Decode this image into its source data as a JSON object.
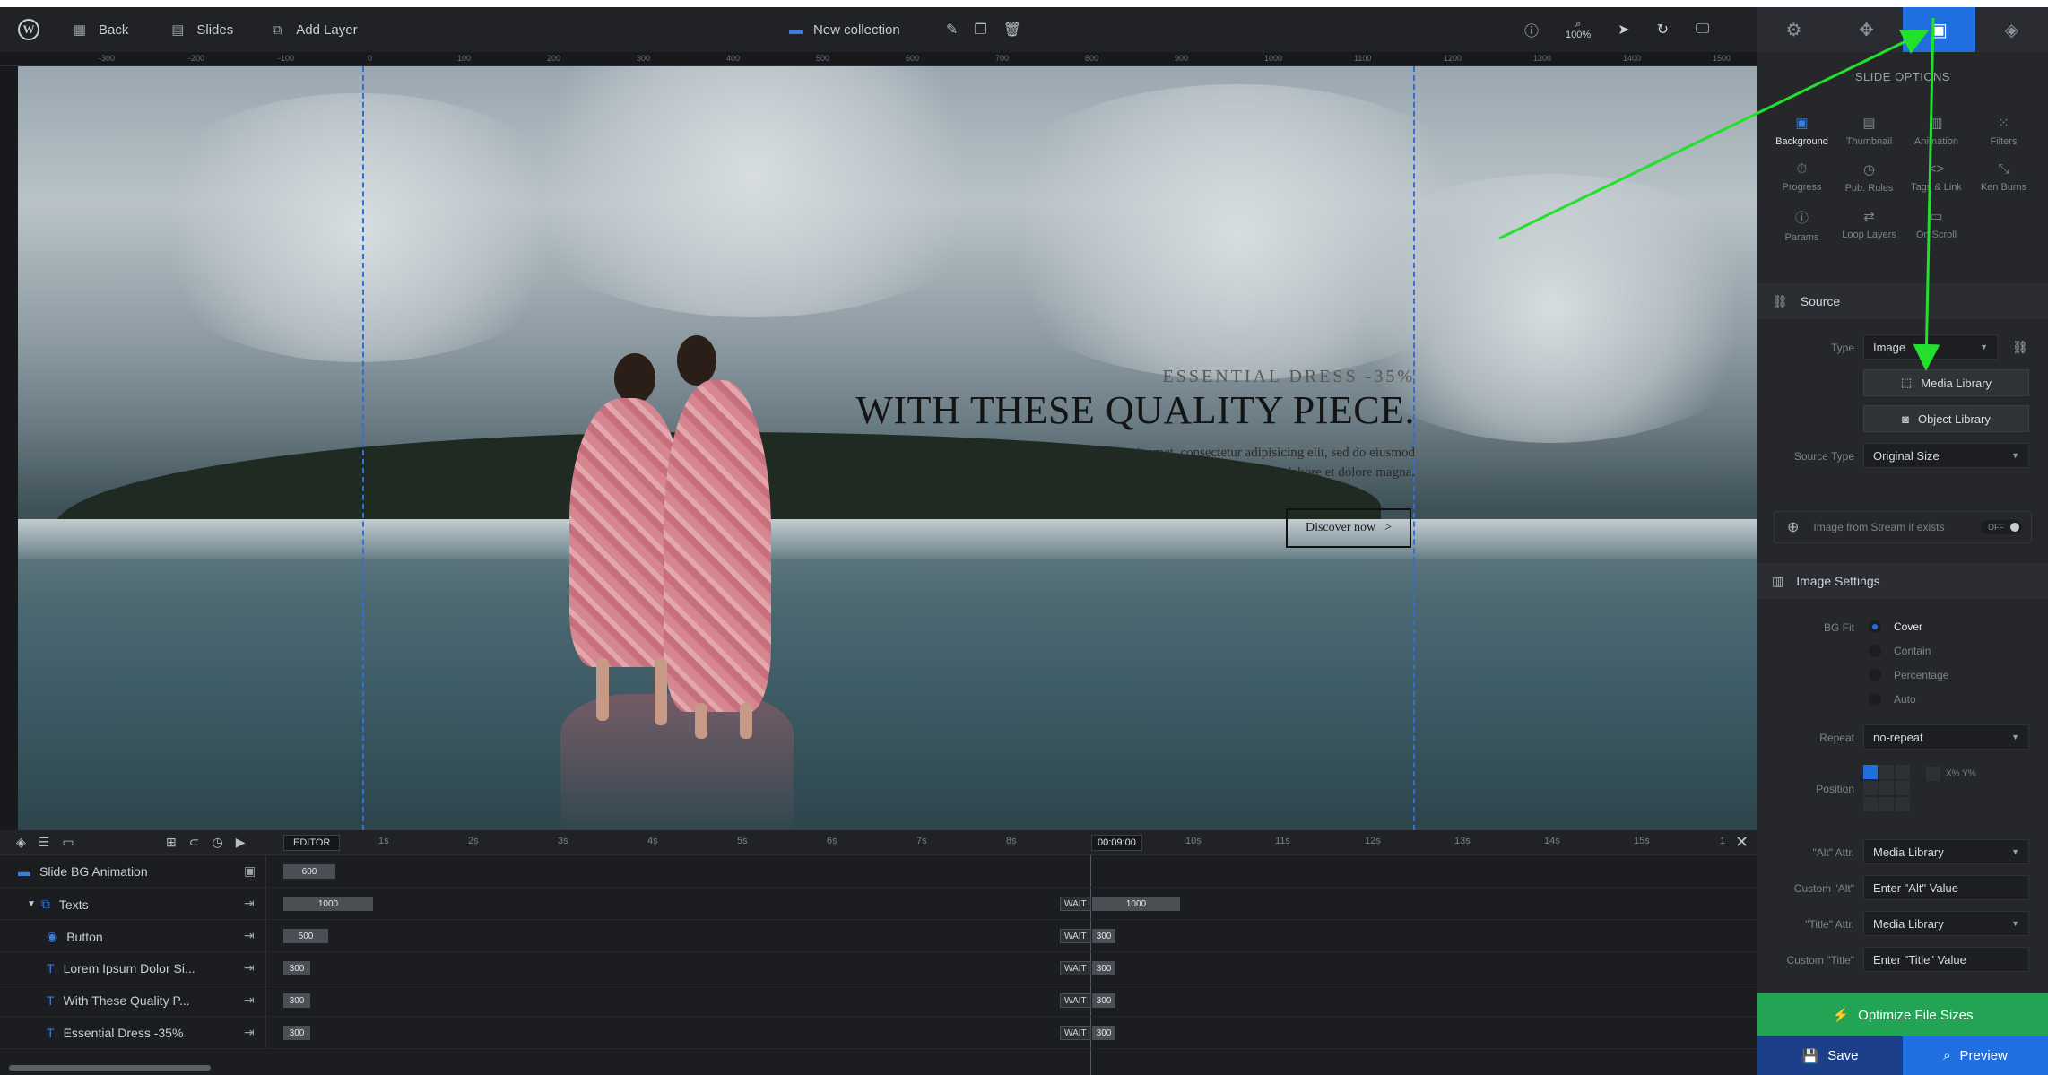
{
  "topbar": {
    "back": "Back",
    "slides": "Slides",
    "add_layer": "Add Layer",
    "collection": "New collection",
    "zoom": "100%"
  },
  "ruler": [
    "-300",
    "-200",
    "-100",
    "0",
    "100",
    "200",
    "300",
    "400",
    "500",
    "600",
    "700",
    "800",
    "900",
    "1000",
    "1100",
    "1200",
    "1300",
    "1400",
    "1500"
  ],
  "slide": {
    "kicker": "ESSENTIAL DRESS -35%",
    "headline": "WITH THESE QUALITY PIECE.",
    "body_line1": "Lorem ipsum dolor sit amet, consectetur adipisicing elit, sed do eiusmod",
    "body_line2": "tempor incididunt ut labore et dolore magna.",
    "cta": "Discover now",
    "cta_arrow": ">"
  },
  "timeline": {
    "editor": "EDITOR",
    "current_time": "00:09:00",
    "ticks": [
      "1s",
      "2s",
      "3s",
      "4s",
      "5s",
      "6s",
      "7s",
      "8s",
      "10s",
      "11s",
      "12s",
      "13s",
      "14s",
      "15s",
      "1"
    ],
    "rows": [
      {
        "name": "Slide BG Animation",
        "bar": "600"
      },
      {
        "name": "Texts",
        "bar": "1000",
        "wait": "WAIT",
        "end": "1000"
      },
      {
        "name": "Button",
        "bar": "500",
        "wait": "WAIT",
        "end": "300"
      },
      {
        "name": "Lorem Ipsum Dolor Si...",
        "bar": "300",
        "wait": "WAIT",
        "end": "300"
      },
      {
        "name": "With These Quality P...",
        "bar": "300",
        "wait": "WAIT",
        "end": "300"
      },
      {
        "name": "Essential Dress -35%",
        "bar": "300",
        "wait": "WAIT",
        "end": "300"
      }
    ]
  },
  "panel": {
    "title": "SLIDE OPTIONS",
    "options": [
      "Background",
      "Thumbnail",
      "Animation",
      "Filters",
      "Progress",
      "Pub. Rules",
      "Tags & Link",
      "Ken Burns",
      "Params",
      "Loop Layers",
      "On Scroll"
    ],
    "source_section": "Source",
    "type_label": "Type",
    "type_value": "Image",
    "media_library": "Media Library",
    "object_library": "Object Library",
    "source_type_label": "Source Type",
    "source_type_value": "Original Size",
    "stream_label": "Image from Stream if exists",
    "stream_toggle": "OFF",
    "image_settings": "Image Settings",
    "bgfit_label": "BG Fit",
    "bgfit_options": [
      "Cover",
      "Contain",
      "Percentage",
      "Auto"
    ],
    "repeat_label": "Repeat",
    "repeat_value": "no-repeat",
    "position_label": "Position",
    "position_xy": "X% Y%",
    "alt_label": "\"Alt\" Attr.",
    "alt_value": "Media Library",
    "custom_alt_label": "Custom \"Alt\"",
    "custom_alt_placeholder": "Enter \"Alt\" Value",
    "title_label": "\"Title\" Attr.",
    "title_value": "Media Library",
    "custom_title_label": "Custom \"Title\"",
    "custom_title_placeholder": "Enter \"Title\" Value",
    "optimize": "Optimize File Sizes",
    "save": "Save",
    "preview": "Preview"
  },
  "colors": {
    "accent": "#1f6fe0",
    "annotation": "#22e02b",
    "optimize": "#23a455"
  }
}
